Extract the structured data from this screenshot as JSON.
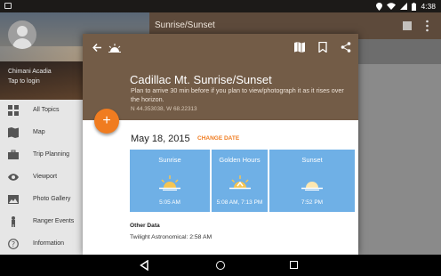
{
  "status_bar": {
    "time": "4:38"
  },
  "drawer": {
    "user_name": "Chimani Acadia",
    "login_text": "Tap to login",
    "items": [
      {
        "label": "All Topics",
        "icon": "grid-icon"
      },
      {
        "label": "Map",
        "icon": "map-icon"
      },
      {
        "label": "Trip Planning",
        "icon": "suitcase-icon"
      },
      {
        "label": "Viewport",
        "icon": "eye-icon"
      },
      {
        "label": "Photo Gallery",
        "icon": "photo-icon"
      },
      {
        "label": "Ranger Events",
        "icon": "ranger-icon"
      },
      {
        "label": "Information",
        "icon": "help-icon"
      }
    ]
  },
  "appbar": {
    "title": "Sunrise/Sunset"
  },
  "modal": {
    "title": "Cadillac Mt. Sunrise/Sunset",
    "description": "Plan to arrive 30 min before if you plan to view/photograph it as it rises over the horizon.",
    "coordinates": "N 44.353038, W 68.22313",
    "fab_label": "+",
    "date": "May 18, 2015",
    "change_date_label": "CHANGE DATE",
    "times": [
      {
        "label": "Sunrise",
        "time": "5:05 AM",
        "icon": "sunrise-icon"
      },
      {
        "label": "Golden Hours",
        "time": "5:08 AM, 7:13 PM",
        "icon": "golden-hour-icon"
      },
      {
        "label": "Sunset",
        "time": "7:52 PM",
        "icon": "sunset-icon"
      }
    ],
    "other_data_title": "Other Data",
    "twilight": "Twilight Astronomical: 2:58 AM"
  },
  "colors": {
    "header_brown": "#735c47",
    "accent_orange": "#f07c20",
    "tile_blue": "#6fb0e6"
  }
}
